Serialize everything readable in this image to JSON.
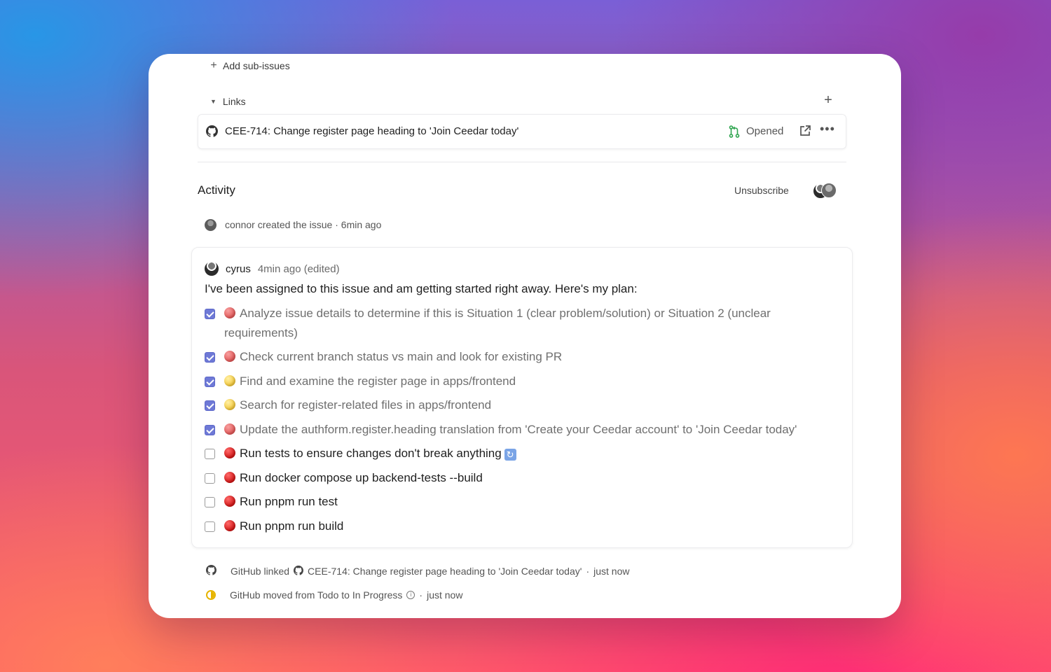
{
  "sub_issues": {
    "add_label": "Add sub-issues"
  },
  "links": {
    "section_label": "Links",
    "items": [
      {
        "title": "CEE-714: Change register page heading to 'Join Ceedar today'",
        "status": "Opened"
      }
    ]
  },
  "activity": {
    "title": "Activity",
    "unsubscribe_label": "Unsubscribe",
    "created_event": {
      "text": "connor created the issue",
      "sep": "·",
      "time": "6min ago"
    },
    "comment": {
      "user": "cyrus",
      "time": "4min ago (edited)",
      "intro": "I've been assigned to this issue and am getting started right away. Here's my plan:",
      "tasks": [
        {
          "checked": true,
          "dot": "red-soft",
          "text": "Analyze issue details to determine if this is Situation 1 (clear problem/solution) or Situation 2 (unclear requirements)"
        },
        {
          "checked": true,
          "dot": "red-soft",
          "text": "Check current branch status vs main and look for existing PR"
        },
        {
          "checked": true,
          "dot": "yellow",
          "text": "Find and examine the register page in apps/frontend"
        },
        {
          "checked": true,
          "dot": "yellow",
          "text": "Search for register-related files in apps/frontend"
        },
        {
          "checked": true,
          "dot": "red-soft",
          "text": "Update the authform.register.heading translation from 'Create your Ceedar account' to 'Join Ceedar today'"
        },
        {
          "checked": false,
          "dot": "red",
          "text": "Run tests to ensure changes don't break anything"
        },
        {
          "checked": false,
          "dot": "red",
          "text": "Run docker compose up backend-tests --build"
        },
        {
          "checked": false,
          "dot": "red",
          "text": "Run pnpm run test"
        },
        {
          "checked": false,
          "dot": "red",
          "text": "Run pnpm run build"
        }
      ]
    },
    "linked_event": {
      "actor": "GitHub linked",
      "target": "CEE-714: Change register page heading to 'Join Ceedar today'",
      "sep": "·",
      "time": "just now"
    },
    "moved_event": {
      "text": "GitHub moved from Todo to In Progress",
      "sep": "·",
      "time": "just now"
    }
  }
}
